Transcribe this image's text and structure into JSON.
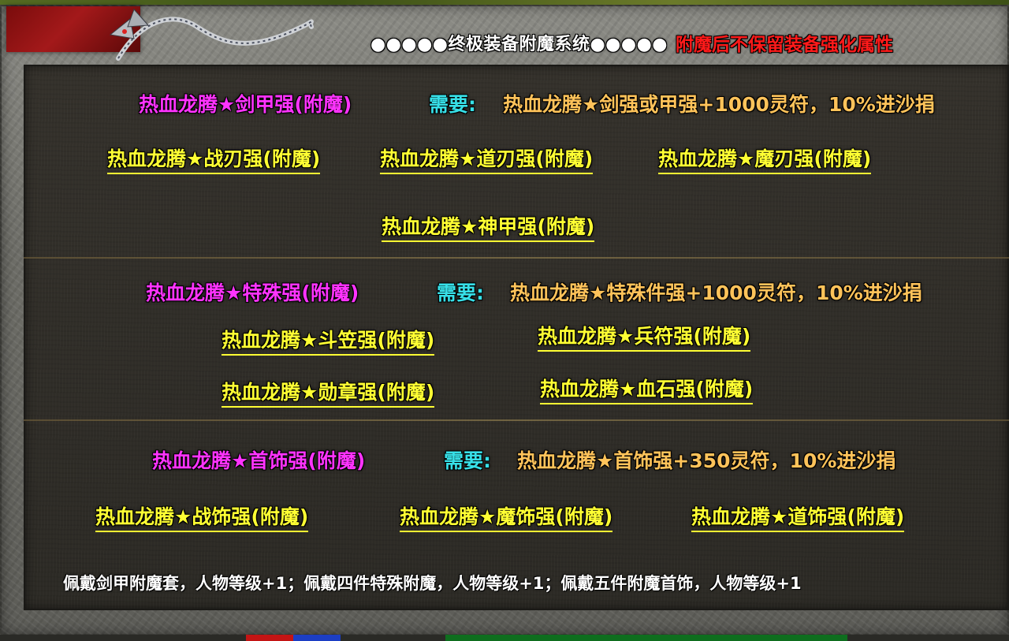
{
  "title": {
    "main": "●●●●●终极装备附魔系统●●●●●",
    "warning": "附魔后不保留装备强化属性"
  },
  "sections": [
    {
      "header": "热血龙腾★剑甲强(附魔)",
      "need_label": "需要:",
      "need_text": "热血龙腾★剑强或甲强+1000灵符，10%进沙捐",
      "links": [
        "热血龙腾★战刃强(附魔)",
        "热血龙腾★道刃强(附魔)",
        "热血龙腾★魔刃强(附魔)",
        "热血龙腾★神甲强(附魔)"
      ]
    },
    {
      "header": "热血龙腾★特殊强(附魔)",
      "need_label": "需要:",
      "need_text": "热血龙腾★特殊件强+1000灵符，10%进沙捐",
      "links": [
        "热血龙腾★斗笠强(附魔)",
        "热血龙腾★兵符强(附魔)",
        "热血龙腾★勋章强(附魔)",
        "热血龙腾★血石强(附魔)"
      ]
    },
    {
      "header": "热血龙腾★首饰强(附魔)",
      "need_label": "需要:",
      "need_text": "热血龙腾★首饰强+350灵符，10%进沙捐",
      "links": [
        "热血龙腾★战饰强(附魔)",
        "热血龙腾★魔饰强(附魔)",
        "热血龙腾★道饰强(附魔)"
      ]
    }
  ],
  "footnote": "佩戴剑甲附魔套，人物等级+1；佩戴四件特殊附魔，人物等级+1；佩戴五件附魔首饰，人物等级+1",
  "colors": {
    "header": "#ff33ff",
    "need_label": "#37e0e8",
    "need_text": "#ffc35a",
    "link": "#ffff33",
    "warning": "#ff1a1a"
  }
}
